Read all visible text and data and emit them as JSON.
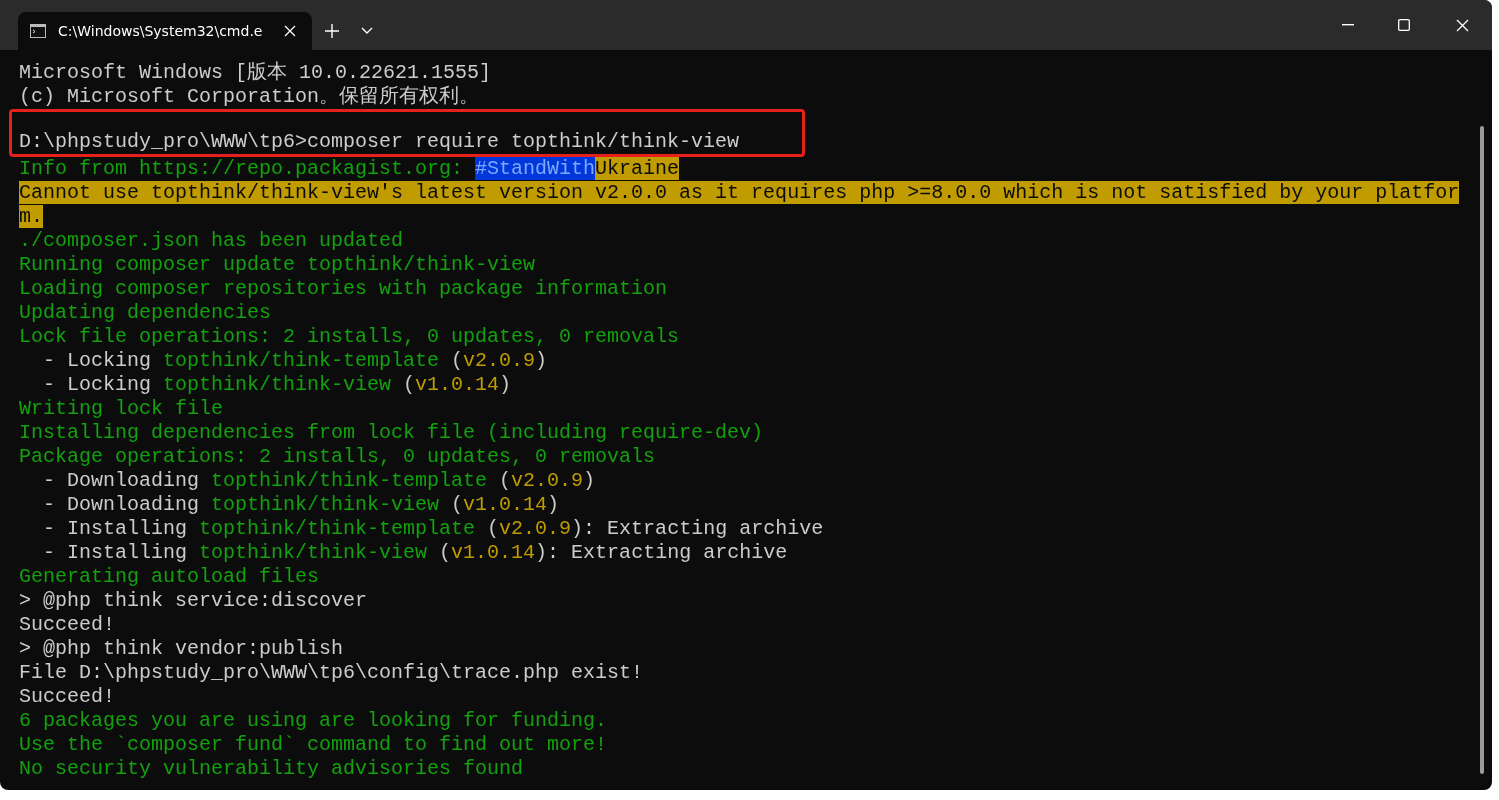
{
  "window": {
    "tab": {
      "title": "C:\\Windows\\System32\\cmd.e",
      "selected": true
    }
  },
  "terminal": {
    "lines": [
      {
        "segments": [
          {
            "text": "Microsoft Windows [版本 10.0.22621.1555]",
            "kind": "plain"
          }
        ]
      },
      {
        "segments": [
          {
            "text": "(c) Microsoft Corporation。保留所有权利。",
            "kind": "plain"
          }
        ]
      },
      {
        "gap_before": true,
        "boxed": true,
        "segments": [
          {
            "text": "D:\\phpstudy_pro\\WWW\\tp6>composer require topthink/think-view",
            "kind": "plain"
          }
        ]
      },
      {
        "segments": [
          {
            "text": "Info from https://repo.packagist.org: ",
            "kind": "success"
          },
          {
            "text": "#StandWith",
            "kind": "selection"
          },
          {
            "text": "Ukraine",
            "kind": "warning"
          }
        ]
      },
      {
        "segments": [
          {
            "text": "Cannot use topthink/think-view's latest version v2.0.0 as it requires php >=8.0.0 which is not satisfied by your platfor",
            "kind": "warning"
          }
        ]
      },
      {
        "segments": [
          {
            "text": "m.",
            "kind": "warning"
          }
        ]
      },
      {
        "segments": [
          {
            "text": "./composer.json has been updated",
            "kind": "success"
          }
        ]
      },
      {
        "segments": [
          {
            "text": "Running composer update topthink/think-view",
            "kind": "success"
          }
        ]
      },
      {
        "segments": [
          {
            "text": "Loading composer repositories with package information",
            "kind": "success"
          }
        ]
      },
      {
        "segments": [
          {
            "text": "Updating dependencies",
            "kind": "success"
          }
        ]
      },
      {
        "segments": [
          {
            "text": "Lock file operations: 2 installs, 0 updates, 0 removals",
            "kind": "success"
          }
        ]
      },
      {
        "segments": [
          {
            "text": "  - Locking ",
            "kind": "plain"
          },
          {
            "text": "topthink/think-template",
            "kind": "success"
          },
          {
            "text": " (",
            "kind": "plain"
          },
          {
            "text": "v2.0.9",
            "kind": "version"
          },
          {
            "text": ")",
            "kind": "plain"
          }
        ]
      },
      {
        "segments": [
          {
            "text": "  - Locking ",
            "kind": "plain"
          },
          {
            "text": "topthink/think-view",
            "kind": "success"
          },
          {
            "text": " (",
            "kind": "plain"
          },
          {
            "text": "v1.0.14",
            "kind": "version"
          },
          {
            "text": ")",
            "kind": "plain"
          }
        ]
      },
      {
        "segments": [
          {
            "text": "Writing lock file",
            "kind": "success"
          }
        ]
      },
      {
        "segments": [
          {
            "text": "Installing dependencies from lock file (including require-dev)",
            "kind": "success"
          }
        ]
      },
      {
        "segments": [
          {
            "text": "Package operations: 2 installs, 0 updates, 0 removals",
            "kind": "success"
          }
        ]
      },
      {
        "segments": [
          {
            "text": "  - Downloading ",
            "kind": "plain"
          },
          {
            "text": "topthink/think-template",
            "kind": "success"
          },
          {
            "text": " (",
            "kind": "plain"
          },
          {
            "text": "v2.0.9",
            "kind": "version"
          },
          {
            "text": ")",
            "kind": "plain"
          }
        ]
      },
      {
        "segments": [
          {
            "text": "  - Downloading ",
            "kind": "plain"
          },
          {
            "text": "topthink/think-view",
            "kind": "success"
          },
          {
            "text": " (",
            "kind": "plain"
          },
          {
            "text": "v1.0.14",
            "kind": "version"
          },
          {
            "text": ")",
            "kind": "plain"
          }
        ]
      },
      {
        "segments": [
          {
            "text": "  - Installing ",
            "kind": "plain"
          },
          {
            "text": "topthink/think-template",
            "kind": "success"
          },
          {
            "text": " (",
            "kind": "plain"
          },
          {
            "text": "v2.0.9",
            "kind": "version"
          },
          {
            "text": "): Extracting archive",
            "kind": "plain"
          }
        ]
      },
      {
        "segments": [
          {
            "text": "  - Installing ",
            "kind": "plain"
          },
          {
            "text": "topthink/think-view",
            "kind": "success"
          },
          {
            "text": " (",
            "kind": "plain"
          },
          {
            "text": "v1.0.14",
            "kind": "version"
          },
          {
            "text": "): Extracting archive",
            "kind": "plain"
          }
        ]
      },
      {
        "segments": [
          {
            "text": "Generating autoload files",
            "kind": "success"
          }
        ]
      },
      {
        "segments": [
          {
            "text": "> @php think service:discover",
            "kind": "plain"
          }
        ]
      },
      {
        "segments": [
          {
            "text": "Succeed!",
            "kind": "plain"
          }
        ]
      },
      {
        "segments": [
          {
            "text": "> @php think vendor:publish",
            "kind": "plain"
          }
        ]
      },
      {
        "segments": [
          {
            "text": "File D:\\phpstudy_pro\\WWW\\tp6\\config\\trace.php exist!",
            "kind": "plain"
          }
        ]
      },
      {
        "segments": [
          {
            "text": "Succeed!",
            "kind": "plain"
          }
        ]
      },
      {
        "segments": [
          {
            "text": "6 packages you are using are looking for funding.",
            "kind": "success"
          }
        ]
      },
      {
        "segments": [
          {
            "text": "Use the `composer fund` command to find out more!",
            "kind": "success"
          }
        ]
      },
      {
        "segments": [
          {
            "text": "No security vulnerability advisories found",
            "kind": "success"
          }
        ]
      }
    ]
  }
}
